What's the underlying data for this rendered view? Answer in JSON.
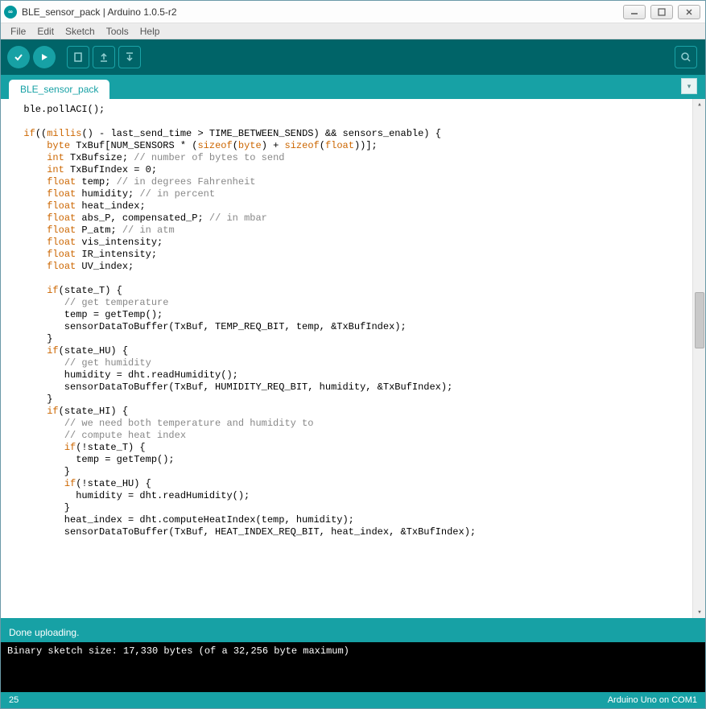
{
  "window": {
    "title": "BLE_sensor_pack | Arduino 1.0.5-r2"
  },
  "menu": {
    "file": "File",
    "edit": "Edit",
    "sketch": "Sketch",
    "tools": "Tools",
    "help": "Help"
  },
  "tab": {
    "name": "BLE_sensor_pack"
  },
  "status": {
    "message": "Done uploading."
  },
  "console": {
    "line1": "Binary sketch size: 17,330 bytes (of a 32,256 byte maximum)"
  },
  "footer": {
    "line": "25",
    "board": "Arduino Uno on COM1"
  },
  "code": {
    "l01": "  ble.pollACI();",
    "l02": "",
    "l03a": "  ",
    "l03b": "if",
    "l03c": "((",
    "l03d": "millis",
    "l03e": "() - last_send_time > TIME_BETWEEN_SENDS) && sensors_enable) {",
    "l04a": "      ",
    "l04b": "byte",
    "l04c": " TxBuf[NUM_SENSORS * (",
    "l04d": "sizeof",
    "l04e": "(",
    "l04f": "byte",
    "l04g": ") + ",
    "l04h": "sizeof",
    "l04i": "(",
    "l04j": "float",
    "l04k": "))];",
    "l05a": "      ",
    "l05b": "int",
    "l05c": " TxBufsize; ",
    "l05d": "// number of bytes to send",
    "l06a": "      ",
    "l06b": "int",
    "l06c": " TxBufIndex = 0;",
    "l07a": "      ",
    "l07b": "float",
    "l07c": " temp; ",
    "l07d": "// in degrees Fahrenheit",
    "l08a": "      ",
    "l08b": "float",
    "l08c": " humidity; ",
    "l08d": "// in percent",
    "l09a": "      ",
    "l09b": "float",
    "l09c": " heat_index;",
    "l10a": "      ",
    "l10b": "float",
    "l10c": " abs_P, compensated_P; ",
    "l10d": "// in mbar",
    "l11a": "      ",
    "l11b": "float",
    "l11c": " P_atm; ",
    "l11d": "// in atm",
    "l12a": "      ",
    "l12b": "float",
    "l12c": " vis_intensity;",
    "l13a": "      ",
    "l13b": "float",
    "l13c": " IR_intensity;",
    "l14a": "      ",
    "l14b": "float",
    "l14c": " UV_index;",
    "l15": "",
    "l16a": "      ",
    "l16b": "if",
    "l16c": "(state_T) {",
    "l17a": "         ",
    "l17b": "// get temperature",
    "l18": "         temp = getTemp();",
    "l19": "         sensorDataToBuffer(TxBuf, TEMP_REQ_BIT, temp, &TxBufIndex);",
    "l20": "      }",
    "l21a": "      ",
    "l21b": "if",
    "l21c": "(state_HU) {",
    "l22a": "         ",
    "l22b": "// get humidity",
    "l23": "         humidity = dht.readHumidity();",
    "l24": "         sensorDataToBuffer(TxBuf, HUMIDITY_REQ_BIT, humidity, &TxBufIndex);",
    "l25": "      }",
    "l26a": "      ",
    "l26b": "if",
    "l26c": "(state_HI) {",
    "l27a": "         ",
    "l27b": "// we need both temperature and humidity to",
    "l28a": "         ",
    "l28b": "// compute heat index",
    "l29a": "         ",
    "l29b": "if",
    "l29c": "(!state_T) {",
    "l30": "           temp = getTemp();",
    "l31": "         }",
    "l32a": "         ",
    "l32b": "if",
    "l32c": "(!state_HU) {",
    "l33": "           humidity = dht.readHumidity();",
    "l34": "         }",
    "l35": "         heat_index = dht.computeHeatIndex(temp, humidity);",
    "l36": "         sensorDataToBuffer(TxBuf, HEAT_INDEX_REQ_BIT, heat_index, &TxBufIndex);"
  }
}
